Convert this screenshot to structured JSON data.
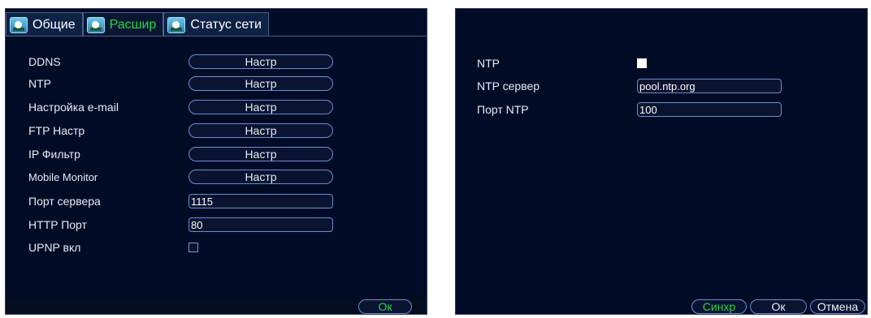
{
  "left_panel": {
    "tabs": [
      {
        "label": "Общие",
        "active": false
      },
      {
        "label": "Расшир",
        "active": true
      },
      {
        "label": "Статус сети",
        "active": false
      }
    ],
    "rows": [
      {
        "label": "DDNS",
        "button": "Настр"
      },
      {
        "label": "NTP",
        "button": "Настр"
      },
      {
        "label": "Настройка e-mail",
        "button": "Настр"
      },
      {
        "label": "FTP Настр",
        "button": "Настр"
      },
      {
        "label": "IP Фильтр",
        "button": "Настр"
      },
      {
        "label": "Mobile Monitor",
        "button": "Настр"
      }
    ],
    "server_port": {
      "label": "Порт сервера",
      "value": "1115"
    },
    "http_port": {
      "label": "HTTP Порт",
      "value": "80"
    },
    "upnp": {
      "label": "UPNP вкл",
      "checked": false
    },
    "ok_label": "Ок"
  },
  "right_panel": {
    "ntp": {
      "label": "NTP",
      "checked": true
    },
    "ntp_server": {
      "label": "NTP сервер",
      "value": "pool.ntp.org"
    },
    "ntp_port": {
      "label": "Порт NTP",
      "value": "100"
    },
    "buttons": {
      "sync": "Синхр",
      "ok": "Ок",
      "cancel": "Отмена"
    }
  },
  "colors": {
    "panel_bg": "#000b26",
    "active_tab_text": "#27d64a",
    "control_border": "#6a8fd0"
  }
}
